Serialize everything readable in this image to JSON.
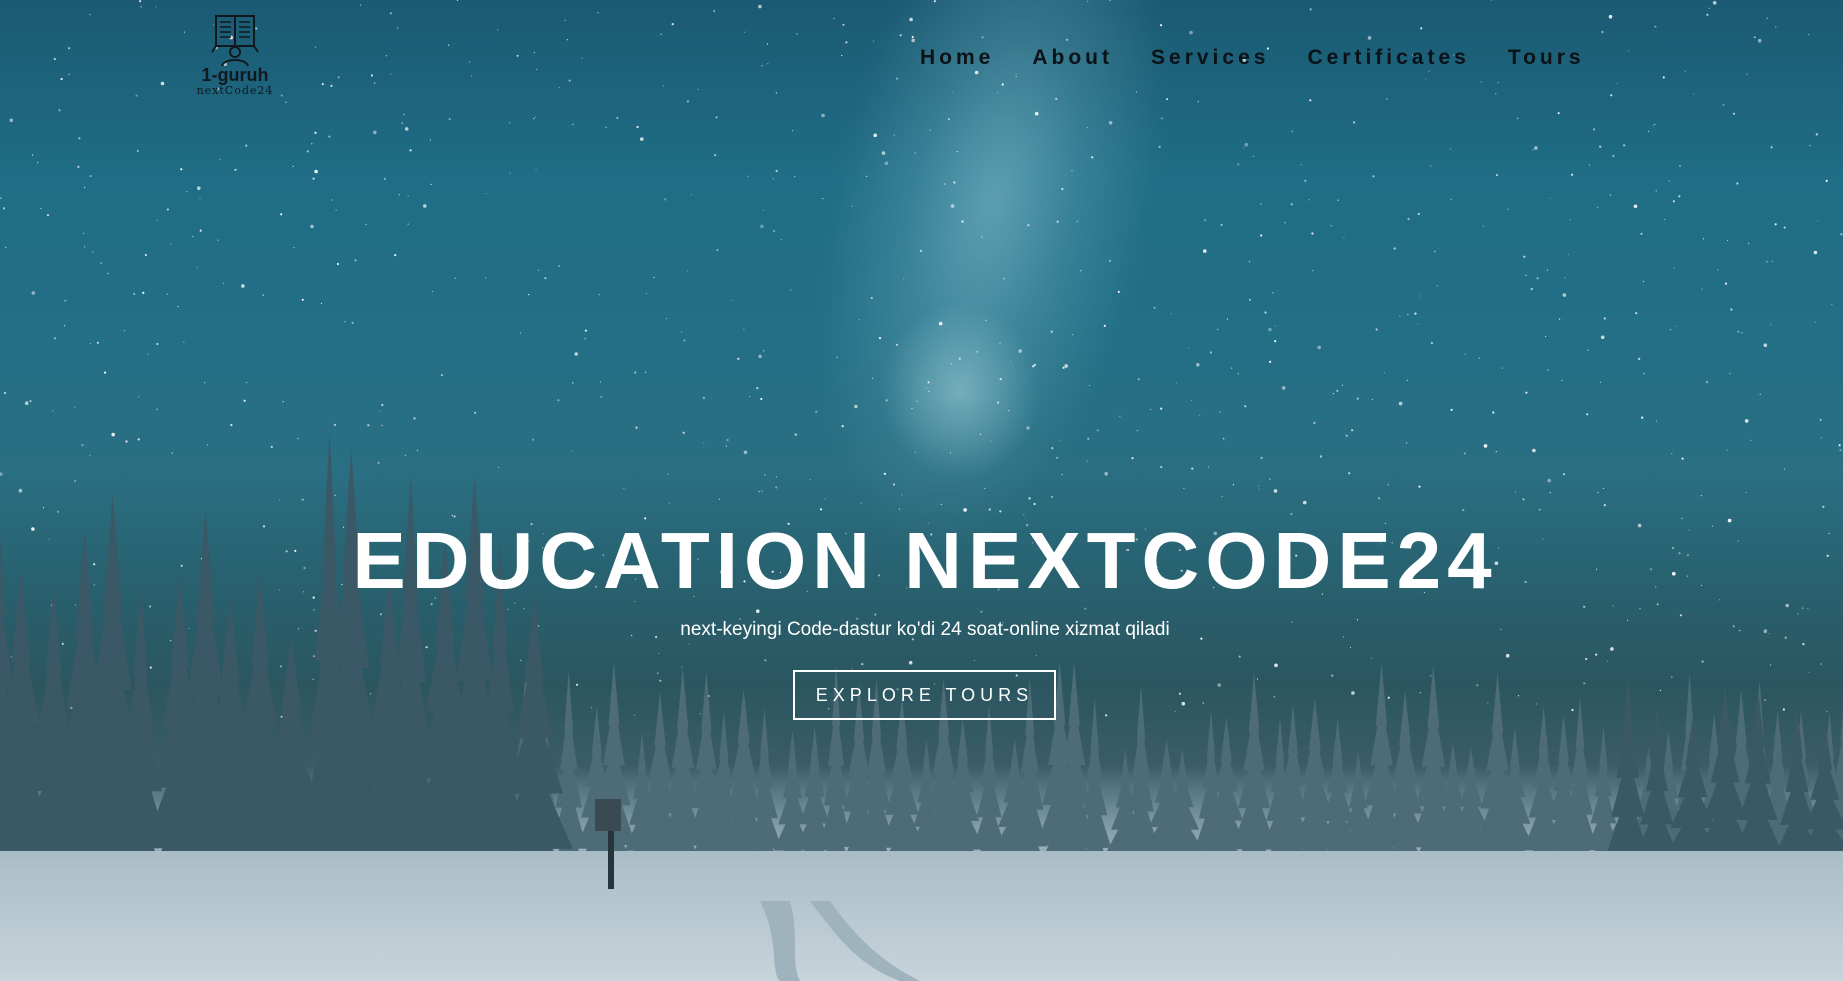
{
  "logo": {
    "icon": "open-book-reader-icon",
    "title": "1-guruh",
    "subtitle": "nextCode24"
  },
  "nav": {
    "items": [
      {
        "label": "Home"
      },
      {
        "label": "About"
      },
      {
        "label": "Services"
      },
      {
        "label": "Certificates"
      },
      {
        "label": "Tours"
      }
    ]
  },
  "hero": {
    "headline": "EDUCATION NEXTCODE24",
    "subtitle": "next-keyingi Code-dastur ko'di 24 soat-online xizmat qiladi",
    "cta_label": "EXPLORE TOURS",
    "background": "snowy-forest-night-sky-image"
  },
  "colors": {
    "nav_text": "#0b1218",
    "hero_text": "#ffffff",
    "sky": "#1f6d86",
    "snow": "#c9d6dc"
  }
}
